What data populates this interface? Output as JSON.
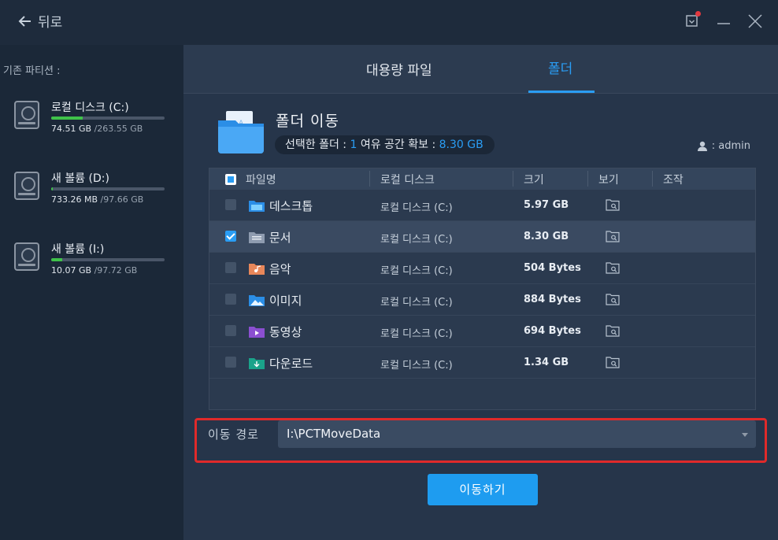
{
  "titlebar": {
    "back_label": "뒤로"
  },
  "sidebar": {
    "heading": "기존 파티션 :",
    "partitions": [
      {
        "name": "로컬 디스크 (C:)",
        "used": "74.51 GB",
        "total": "/263.55 GB",
        "fill": 0.28,
        "color": "#3fc24a"
      },
      {
        "name": "새 볼륨 (D:)",
        "used": "733.26 MB",
        "total": "/97.66 GB",
        "fill": 0.007,
        "color": "#3fc24a"
      },
      {
        "name": "새 볼륨 (I:)",
        "used": "10.07 GB",
        "total": "/97.72 GB",
        "fill": 0.1,
        "color": "#3fc24a"
      }
    ]
  },
  "tabs": [
    {
      "label": "대용량 파일",
      "active": false
    },
    {
      "label": "폴더",
      "active": true
    }
  ],
  "header": {
    "title": "폴더 이동",
    "sel_prefix": "선택한 폴더 : ",
    "sel_count": "1",
    "space_prefix": " 여유 공간 확보 : ",
    "space_value": "8.30 GB",
    "user": ": admin"
  },
  "table": {
    "columns": {
      "name": "파일명",
      "disk": "로컬 디스크",
      "size": "크기",
      "view": "보기",
      "action": "조작"
    },
    "rows": [
      {
        "name": "데스크톱",
        "disk": "로컬 디스크 (C:)",
        "size": "5.97 GB",
        "checked": false,
        "icon": "desktop-folder-icon"
      },
      {
        "name": "문서",
        "disk": "로컬 디스크 (C:)",
        "size": "8.30 GB",
        "checked": true,
        "icon": "documents-folder-icon"
      },
      {
        "name": "음악",
        "disk": "로컬 디스크 (C:)",
        "size": "504 Bytes",
        "checked": false,
        "icon": "music-folder-icon"
      },
      {
        "name": "이미지",
        "disk": "로컬 디스크 (C:)",
        "size": "884 Bytes",
        "checked": false,
        "icon": "pictures-folder-icon"
      },
      {
        "name": "동영상",
        "disk": "로컬 디스크 (C:)",
        "size": "694 Bytes",
        "checked": false,
        "icon": "videos-folder-icon"
      },
      {
        "name": "다운로드",
        "disk": "로컬 디스크 (C:)",
        "size": "1.34 GB",
        "checked": false,
        "icon": "downloads-folder-icon"
      }
    ]
  },
  "path": {
    "label": "이동 경로",
    "value": "I:\\PCTMoveData"
  },
  "move_button": "이동하기",
  "colors": {
    "accent": "#2a9df4",
    "highlight": "#e02a2a",
    "progress": "#3fc24a"
  }
}
